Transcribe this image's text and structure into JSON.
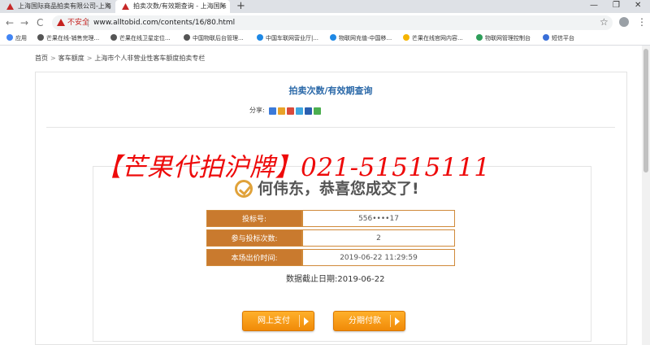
{
  "browser": {
    "tabs": [
      {
        "label": "上海国际商品拍卖有限公司-上海",
        "active": false
      },
      {
        "label": "拍卖次数/有效期查询 - 上海国际",
        "active": true
      }
    ],
    "new_tab": "+",
    "window": {
      "minimize": "—",
      "maximize": "❐",
      "close": "✕"
    },
    "nav": {
      "back": "←",
      "forward": "→",
      "reload": "C"
    },
    "address": {
      "security_label": "不安全",
      "url": "www.alltobid.com/contents/16/80.html"
    },
    "star": "☆",
    "menu": "⋮",
    "bookmarks": [
      {
        "label": "应用",
        "color": "#4285f4"
      },
      {
        "label": "芒果在线-销售完理...",
        "color": "#555555"
      },
      {
        "label": "芒果在线卫星定位...",
        "color": "#555555"
      },
      {
        "label": "中国物联后台管理...",
        "color": "#555555"
      },
      {
        "label": "中国车联网营业厅|...",
        "color": "#1e88e5"
      },
      {
        "label": "物联网充值-中国移...",
        "color": "#1e88e5"
      },
      {
        "label": "芒果在线官网内容...",
        "color": "#f5b400"
      },
      {
        "label": "物联网管理控制台",
        "color": "#2e9e5a"
      },
      {
        "label": "短信平台",
        "color": "#3a6fd8"
      }
    ]
  },
  "breadcrumb": [
    "首页",
    "客车额度",
    "上海市个人非营业性客车额度拍卖专栏"
  ],
  "breadcrumb_sep": ">",
  "page": {
    "title": "拍卖次数/有效期查询",
    "share_label": "分享:",
    "share_colors": [
      "#3b7ad9",
      "#e8a228",
      "#d94a3b",
      "#3ea6e0",
      "#2b5fb0",
      "#4caf50"
    ],
    "overlay_ad": "【芒果代拍沪牌】021-51515111",
    "congrats": "何伟东，恭喜您成交了!",
    "info_rows": [
      {
        "label": "投标号:",
        "value": "556••••17"
      },
      {
        "label": "参与投标次数:",
        "value": "2"
      },
      {
        "label": "本场出价时间:",
        "value": "2019-06-22 11:29:59"
      }
    ],
    "deadline": "数据截止日期:2019-06-22",
    "buttons": {
      "online_pay": "网上支付",
      "installment_pay": "分期付款"
    }
  },
  "colors": {
    "accent_orange": "#c97a2e",
    "ad_red": "#ee0a0a",
    "title_blue": "#2a68a8"
  }
}
